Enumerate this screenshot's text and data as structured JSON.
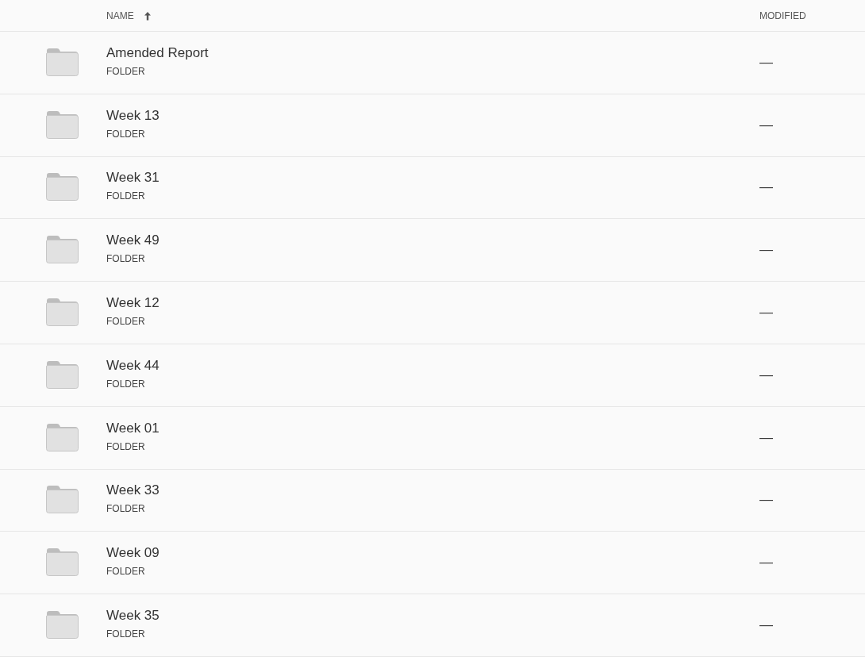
{
  "table": {
    "columns": [
      {
        "label": "NAME",
        "sorted": true
      },
      {
        "label": "MODIFIED",
        "sorted": false
      }
    ],
    "rows": [
      {
        "name": "Amended Report",
        "type": "FOLDER",
        "modified": "—"
      },
      {
        "name": "Week 13",
        "type": "FOLDER",
        "modified": "—"
      },
      {
        "name": "Week 31",
        "type": "FOLDER",
        "modified": "—"
      },
      {
        "name": "Week 49",
        "type": "FOLDER",
        "modified": "—"
      },
      {
        "name": "Week 12",
        "type": "FOLDER",
        "modified": "—"
      },
      {
        "name": "Week 44",
        "type": "FOLDER",
        "modified": "—"
      },
      {
        "name": "Week 01",
        "type": "FOLDER",
        "modified": "—"
      },
      {
        "name": "Week 33",
        "type": "FOLDER",
        "modified": "—"
      },
      {
        "name": "Week 09",
        "type": "FOLDER",
        "modified": "—"
      },
      {
        "name": "Week 35",
        "type": "FOLDER",
        "modified": "—"
      }
    ]
  }
}
